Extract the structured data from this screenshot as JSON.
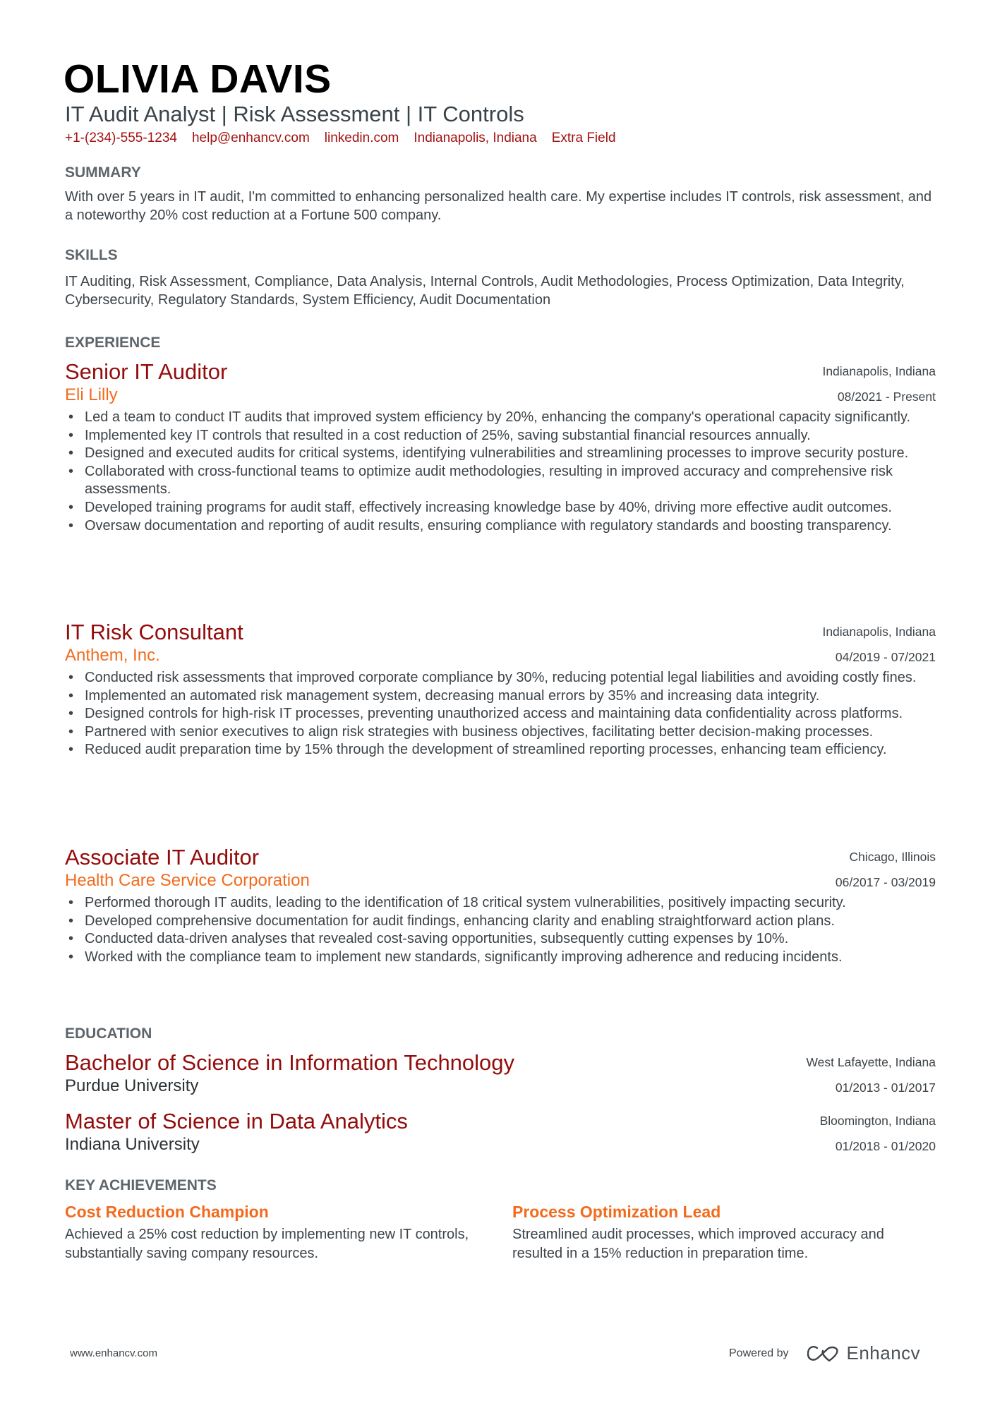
{
  "header": {
    "name": "OLIVIA DAVIS",
    "subtitle": "IT Audit Analyst | Risk Assessment | IT Controls",
    "contact": [
      "+1-(234)-555-1234",
      "help@enhancv.com",
      "linkedin.com",
      "Indianapolis, Indiana",
      "Extra Field"
    ]
  },
  "summary": {
    "heading": "SUMMARY",
    "text": "With over 5 years in IT audit, I'm committed to enhancing personalized health care. My expertise includes IT controls, risk assessment, and a noteworthy 20% cost reduction at a Fortune 500 company."
  },
  "skills": {
    "heading": "SKILLS",
    "text": "IT Auditing, Risk Assessment, Compliance, Data Analysis, Internal Controls, Audit Methodologies, Process Optimization, Data Integrity, Cybersecurity, Regulatory Standards, System Efficiency, Audit Documentation"
  },
  "experience": {
    "heading": "EXPERIENCE",
    "jobs": [
      {
        "title": "Senior IT Auditor",
        "company": "Eli Lilly",
        "location": "Indianapolis, Indiana",
        "dates": "08/2021 - Present",
        "bullets": [
          "Led a team to conduct IT audits that improved system efficiency by 20%, enhancing the company's operational capacity significantly.",
          "Implemented key IT controls that resulted in a cost reduction of 25%, saving substantial financial resources annually.",
          "Designed and executed audits for critical systems, identifying vulnerabilities and streamlining processes to improve security posture.",
          "Collaborated with cross-functional teams to optimize audit methodologies, resulting in improved accuracy and comprehensive risk assessments.",
          "Developed training programs for audit staff, effectively increasing knowledge base by 40%, driving more effective audit outcomes.",
          "Oversaw documentation and reporting of audit results, ensuring compliance with regulatory standards and boosting transparency."
        ]
      },
      {
        "title": "IT Risk Consultant",
        "company": "Anthem, Inc.",
        "location": "Indianapolis, Indiana",
        "dates": "04/2019 - 07/2021",
        "bullets": [
          "Conducted risk assessments that improved corporate compliance by 30%, reducing potential legal liabilities and avoiding costly fines.",
          "Implemented an automated risk management system, decreasing manual errors by 35% and increasing data integrity.",
          "Designed controls for high-risk IT processes, preventing unauthorized access and maintaining data confidentiality across platforms.",
          "Partnered with senior executives to align risk strategies with business objectives, facilitating better decision-making processes.",
          "Reduced audit preparation time by 15% through the development of streamlined reporting processes, enhancing team efficiency."
        ]
      },
      {
        "title": "Associate IT Auditor",
        "company": "Health Care Service Corporation",
        "location": "Chicago, Illinois",
        "dates": "06/2017 - 03/2019",
        "bullets": [
          "Performed thorough IT audits, leading to the identification of 18 critical system vulnerabilities, positively impacting security.",
          "Developed comprehensive documentation for audit findings, enhancing clarity and enabling straightforward action plans.",
          "Conducted data-driven analyses that revealed cost-saving opportunities, subsequently cutting expenses by 10%.",
          "Worked with the compliance team to implement new standards, significantly improving adherence and reducing incidents."
        ]
      }
    ]
  },
  "education": {
    "heading": "EDUCATION",
    "items": [
      {
        "degree": "Bachelor of Science in Information Technology",
        "school": "Purdue University",
        "location": "West Lafayette, Indiana",
        "dates": "01/2013 - 01/2017"
      },
      {
        "degree": "Master of Science in Data Analytics",
        "school": "Indiana University",
        "location": "Bloomington, Indiana",
        "dates": "01/2018 - 01/2020"
      }
    ]
  },
  "achievements": {
    "heading": "KEY ACHIEVEMENTS",
    "items": [
      {
        "title": "Cost Reduction Champion",
        "description": "Achieved a 25% cost reduction by implementing new IT controls, substantially saving company resources."
      },
      {
        "title": "Process Optimization Lead",
        "description": "Streamlined audit processes, which improved accuracy and resulted in a 15% reduction in preparation time."
      }
    ]
  },
  "footer": {
    "website": "www.enhancv.com",
    "powered_by": "Powered by",
    "brand_icon": "enhancv-logo-icon",
    "brand_name": "Enhancv"
  },
  "colors": {
    "title_red": "#930c0c",
    "company_orange": "#f26b1d",
    "contact_red": "#a31212",
    "heading_gray": "#5d656b"
  }
}
